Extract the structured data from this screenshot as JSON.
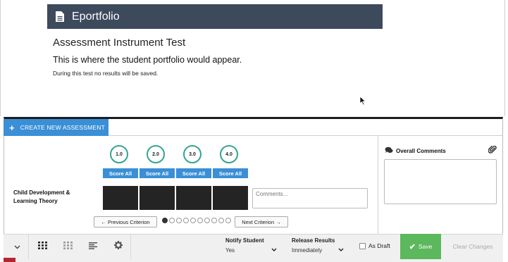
{
  "portfolio": {
    "bar_title": "Eportfolio",
    "heading": "Assessment Instrument Test",
    "subheading": "This is where the student portfolio would appear.",
    "note": "During this test no results will be saved."
  },
  "assessment": {
    "create_button": "CREATE NEW ASSESSMENT",
    "scores": [
      {
        "value": "1.0",
        "score_all": "Score All"
      },
      {
        "value": "2.0",
        "score_all": "Score All"
      },
      {
        "value": "3.0",
        "score_all": "Score All"
      },
      {
        "value": "4.0",
        "score_all": "Score All"
      }
    ],
    "criterion_label": "Child Development & Learning Theory",
    "comments_placeholder": "Comments...",
    "prev_criterion": "← Previous Criterion",
    "next_criterion": "Next Criterion →",
    "pagination": {
      "total": 10,
      "current": 1
    },
    "overall_comments_label": "Overall Comments"
  },
  "toolbar": {
    "notify_student": {
      "label": "Notify Student",
      "value": "Yes"
    },
    "release_results": {
      "label": "Release Results",
      "value": "Immediately"
    },
    "as_draft": {
      "label": "As Draft",
      "checked": false
    },
    "save_label": "Save",
    "clear_changes_label": "Clear Changes"
  },
  "colors": {
    "header_bar": "#3c4a5c",
    "accent_blue": "#3a8fd6",
    "score_ring": "#33a58f",
    "save_green": "#5cb85c",
    "rubric_cell": "#242424"
  },
  "icons": [
    "document-icon",
    "plus-icon",
    "chevron-down-icon",
    "grid-view-icon",
    "dotted-grid-icon",
    "align-left-icon",
    "gear-icon",
    "comment-icon",
    "paperclip-icon",
    "checkmark-icon",
    "mouse-cursor-icon"
  ]
}
